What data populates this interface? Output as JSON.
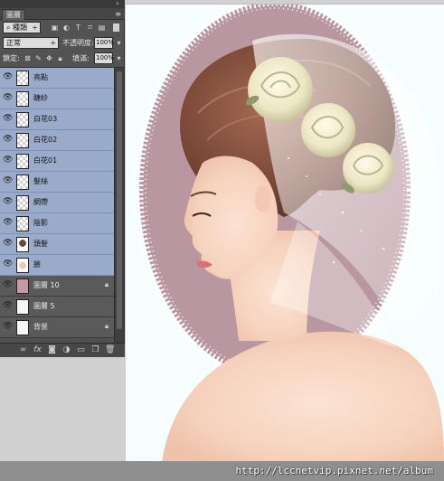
{
  "panel": {
    "tab_label": "圖層",
    "filter_kind": "種類",
    "blend_mode": "正常",
    "opacity_label": "不透明度:",
    "opacity_value": "100%",
    "lock_label": "鎖定:",
    "fill_label": "填滿:",
    "fill_value": "100%"
  },
  "layers": [
    {
      "name": "亮點",
      "selected": true,
      "thumb": "transparent",
      "locked": false
    },
    {
      "name": "睫紗",
      "selected": true,
      "thumb": "transparent",
      "locked": false
    },
    {
      "name": "白花03",
      "selected": true,
      "thumb": "transparent",
      "locked": false
    },
    {
      "name": "白花02",
      "selected": true,
      "thumb": "transparent",
      "locked": false
    },
    {
      "name": "白花01",
      "selected": true,
      "thumb": "transparent",
      "locked": false
    },
    {
      "name": "髮絲",
      "selected": true,
      "thumb": "transparent",
      "locked": false
    },
    {
      "name": "網帶",
      "selected": true,
      "thumb": "transparent",
      "locked": false
    },
    {
      "name": "陰影",
      "selected": true,
      "thumb": "transparent",
      "locked": false
    },
    {
      "name": "頭髮",
      "selected": true,
      "thumb": "hair",
      "locked": false
    },
    {
      "name": "臉",
      "selected": true,
      "thumb": "face",
      "locked": false
    },
    {
      "name": "圖層 10",
      "selected": false,
      "thumb": "solid-pink",
      "locked": true
    },
    {
      "name": "圖層 5",
      "selected": false,
      "thumb": "solid-white",
      "locked": false
    },
    {
      "name": "背景",
      "selected": false,
      "thumb": "solid-white",
      "locked": true
    }
  ],
  "footer_icons": [
    "link-icon",
    "fx-icon",
    "mask-icon",
    "adjustment-icon",
    "group-icon",
    "new-layer-icon",
    "trash-icon"
  ],
  "watermark": "http://lccnetvip.pixnet.net/album",
  "colors": {
    "selected_layer": "#9aaacb",
    "panel_bg": "#535353",
    "canvas_bg": "#f6fdff",
    "mauve_backdrop": "#b897a0"
  }
}
